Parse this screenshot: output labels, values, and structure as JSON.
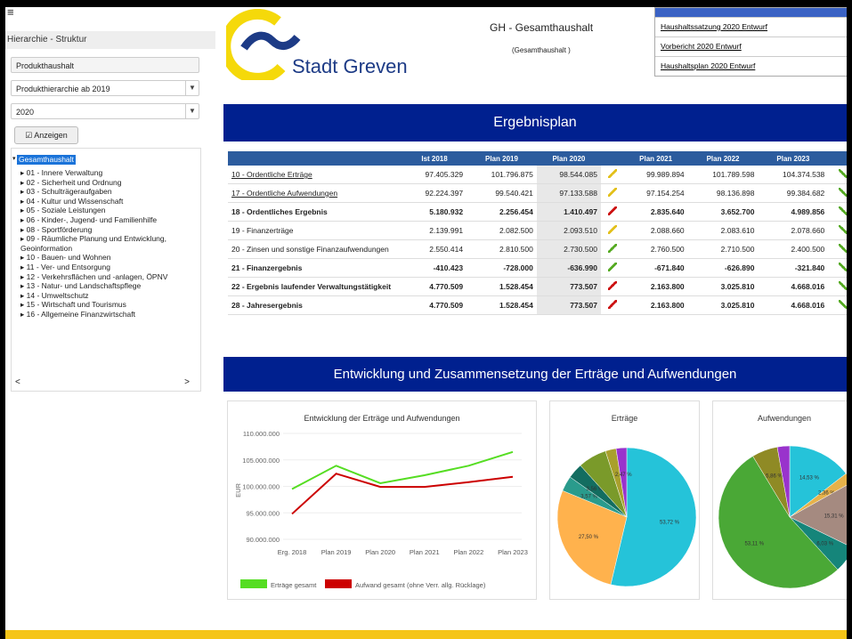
{
  "sidebar": {
    "menu_icon": "hamburger-icon",
    "header": "Hierarchie - Struktur",
    "field1": "Produkthaushalt",
    "field2": "Produkthierarchie ab 2019",
    "field3": "2020",
    "button": "Anzeigen",
    "tree_root": "Gesamthaushalt",
    "tree_items": [
      "01 - Innere Verwaltung",
      "02 - Sicherheit und Ordnung",
      "03 - Schulträgeraufgaben",
      "04 - Kultur und Wissenschaft",
      "05 - Soziale Leistungen",
      "06 - Kinder-, Jugend- und Familienhilfe",
      "08 - Sportförderung",
      "09 - Räumliche Planung und Entwicklung, Geoinformation",
      "10 - Bauen- und Wohnen",
      "11 - Ver- und Entsorgung",
      "12 - Verkehrsflächen und -anlagen, ÖPNV",
      "13 - Natur- und Landschaftspflege",
      "14 - Umweltschutz",
      "15 - Wirtschaft und Tourismus",
      "16 - Allgemeine Finanzwirtschaft"
    ]
  },
  "header": {
    "city": "Stadt Greven",
    "title": "GH - Gesamthaushalt",
    "subtitle": "(Gesamthaushalt )",
    "links": [
      "Haushaltssatzung 2020 Entwurf",
      "Vorbericht 2020 Entwurf",
      "Haushaltsplan 2020 Entwurf"
    ]
  },
  "section1": "Ergebnisplan",
  "table": {
    "columns": [
      "Ist 2018",
      "Plan 2019",
      "Plan 2020",
      "",
      "Plan 2021",
      "Plan 2022",
      "Plan 2023",
      ""
    ],
    "rows": [
      {
        "label": "10 - Ordentliche Erträge",
        "vals": [
          "97.405.329",
          "101.796.875",
          "98.544.085"
        ],
        "plan": [
          "99.989.894",
          "101.789.598",
          "104.374.538"
        ],
        "bold": false,
        "link": true
      },
      {
        "label": "17 - Ordentliche Aufwendungen",
        "vals": [
          "92.224.397",
          "99.540.421",
          "97.133.588"
        ],
        "plan": [
          "97.154.254",
          "98.136.898",
          "99.384.682"
        ],
        "bold": false,
        "link": true
      },
      {
        "label": "18 - Ordentliches Ergebnis",
        "vals": [
          "5.180.932",
          "2.256.454",
          "1.410.497"
        ],
        "plan": [
          "2.835.640",
          "3.652.700",
          "4.989.856"
        ],
        "bold": true,
        "link": false
      },
      {
        "label": "19 - Finanzerträge",
        "vals": [
          "2.139.991",
          "2.082.500",
          "2.093.510"
        ],
        "plan": [
          "2.088.660",
          "2.083.610",
          "2.078.660"
        ],
        "bold": false,
        "link": false
      },
      {
        "label": "20 - Zinsen und sonstige Finanzaufwendungen",
        "vals": [
          "2.550.414",
          "2.810.500",
          "2.730.500"
        ],
        "plan": [
          "2.760.500",
          "2.710.500",
          "2.400.500"
        ],
        "bold": false,
        "link": false
      },
      {
        "label": "21 - Finanzergebnis",
        "vals": [
          "-410.423",
          "-728.000",
          "-636.990"
        ],
        "plan": [
          "-671.840",
          "-626.890",
          "-321.840"
        ],
        "bold": true,
        "link": false
      },
      {
        "label": "22 - Ergebnis laufender Verwaltungstätigkeit",
        "vals": [
          "4.770.509",
          "1.528.454",
          "773.507"
        ],
        "plan": [
          "2.163.800",
          "3.025.810",
          "4.668.016"
        ],
        "bold": true,
        "link": false
      },
      {
        "label": "28 - Jahresergebnis",
        "vals": [
          "4.770.509",
          "1.528.454",
          "773.507"
        ],
        "plan": [
          "2.163.800",
          "3.025.810",
          "4.668.016"
        ],
        "bold": true,
        "link": false
      }
    ]
  },
  "section2": "Entwicklung und Zusammensetzung der Erträge und Aufwendungen",
  "chart_data": [
    {
      "type": "line",
      "title": "Entwicklung der Erträge und Aufwendungen",
      "ylabel": "EUR",
      "categories": [
        "Erg. 2018",
        "Plan 2019",
        "Plan 2020",
        "Plan 2021",
        "Plan 2022",
        "Plan 2023"
      ],
      "ylim": [
        90000000,
        110000000
      ],
      "yticks": [
        "90.000.000",
        "95.000.000",
        "100.000.000",
        "105.000.000",
        "110.000.000"
      ],
      "series": [
        {
          "name": "Erträge gesamt",
          "color": "#55dd22",
          "values": [
            99500000,
            103900000,
            100600000,
            102100000,
            103900000,
            106500000
          ]
        },
        {
          "name": "Aufwand gesamt (ohne Verr. allg. Rücklage)",
          "color": "#cc0000",
          "values": [
            94800000,
            102400000,
            99900000,
            99900000,
            100800000,
            101800000
          ]
        }
      ]
    },
    {
      "type": "pie",
      "title": "Erträge",
      "slices": [
        {
          "value": 53.72,
          "label": "53,72 %",
          "color": "#25c3d9"
        },
        {
          "value": 27.5,
          "label": "27,50 %",
          "color": "#ffb24d"
        },
        {
          "value": 3.57,
          "label": "3,57 %",
          "color": "#2a9b8c"
        },
        {
          "value": 3.56,
          "label": "3,56 %",
          "color": "#136d60"
        },
        {
          "value": 6.68,
          "label": "",
          "color": "#7a9a2a"
        },
        {
          "value": 2.5,
          "label": "",
          "color": "#a9a02c"
        },
        {
          "value": 2.47,
          "label": "2,47 %",
          "color": "#9933cc"
        }
      ]
    },
    {
      "type": "pie",
      "title": "Aufwendungen",
      "slices": [
        {
          "value": 14.53,
          "label": "14,53 %",
          "color": "#25c3d9"
        },
        {
          "value": 2.36,
          "label": "2,36 %",
          "color": "#e6b24a"
        },
        {
          "value": 15.31,
          "label": "15,31 %",
          "color": "#a58a80"
        },
        {
          "value": 6.03,
          "label": "6,03 %",
          "color": "#15857a"
        },
        {
          "value": 53.11,
          "label": "53,11 %",
          "color": "#4aa836"
        },
        {
          "value": 5.86,
          "label": "5,86 %",
          "color": "#8f8a25"
        },
        {
          "value": 2.8,
          "label": "",
          "color": "#9933cc"
        }
      ]
    }
  ]
}
